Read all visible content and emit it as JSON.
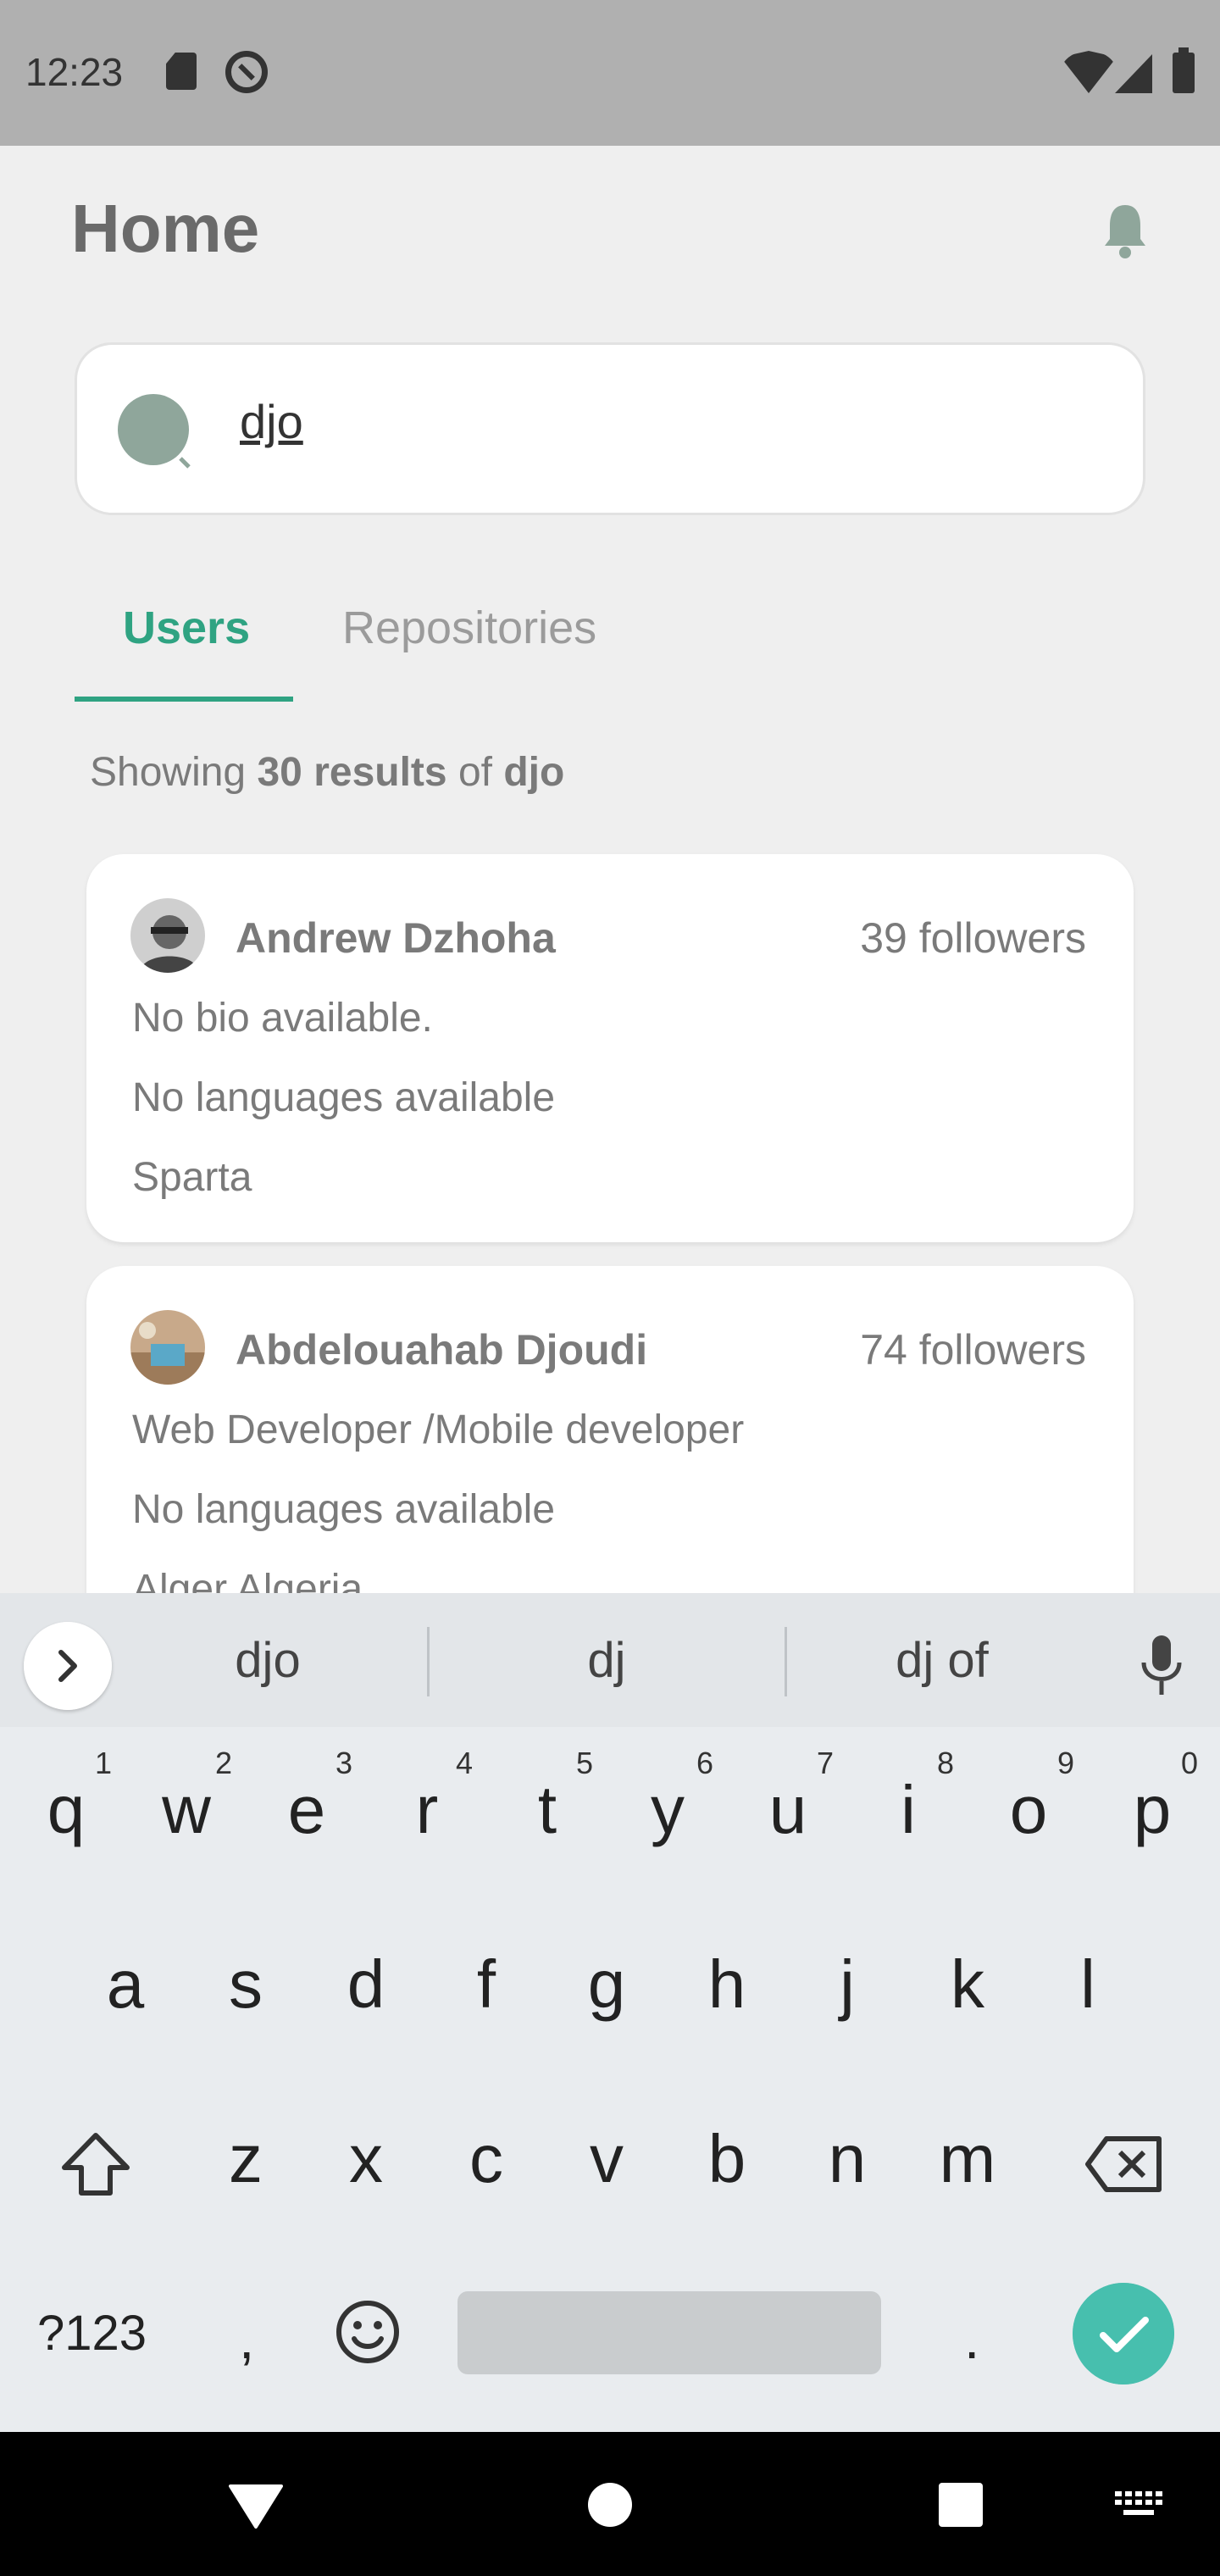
{
  "status_bar": {
    "time": "12:23"
  },
  "header": {
    "title": "Home"
  },
  "search": {
    "value": "djo"
  },
  "tabs": [
    {
      "label": "Users"
    },
    {
      "label": "Repositories"
    }
  ],
  "summary": {
    "prefix": "Showing",
    "count": "30 results",
    "mid": "of",
    "query": "djo"
  },
  "users": [
    {
      "name": "Andrew Dzhoha",
      "followers": "39 followers",
      "bio": "No bio available.",
      "languages": "No languages available",
      "location": "Sparta"
    },
    {
      "name": "Abdelouahab Djoudi",
      "followers": "74 followers",
      "bio": "Web Developer /Mobile developer",
      "languages": "No languages available",
      "location": "Alger Algeria"
    }
  ],
  "keyboard": {
    "suggestions": [
      "djo",
      "dj",
      "dj of"
    ],
    "row1": [
      "q",
      "w",
      "e",
      "r",
      "t",
      "y",
      "u",
      "i",
      "o",
      "p"
    ],
    "row1_hints": [
      "1",
      "2",
      "3",
      "4",
      "5",
      "6",
      "7",
      "8",
      "9",
      "0"
    ],
    "row2": [
      "a",
      "s",
      "d",
      "f",
      "g",
      "h",
      "j",
      "k",
      "l"
    ],
    "row3": [
      "z",
      "x",
      "c",
      "v",
      "b",
      "n",
      "m"
    ],
    "symbols_key": "?123",
    "comma_key": ",",
    "period_key": "."
  },
  "colors": {
    "accent": "#2fa382",
    "enter": "#47bfae",
    "status_bar": "#b0b0b0"
  }
}
